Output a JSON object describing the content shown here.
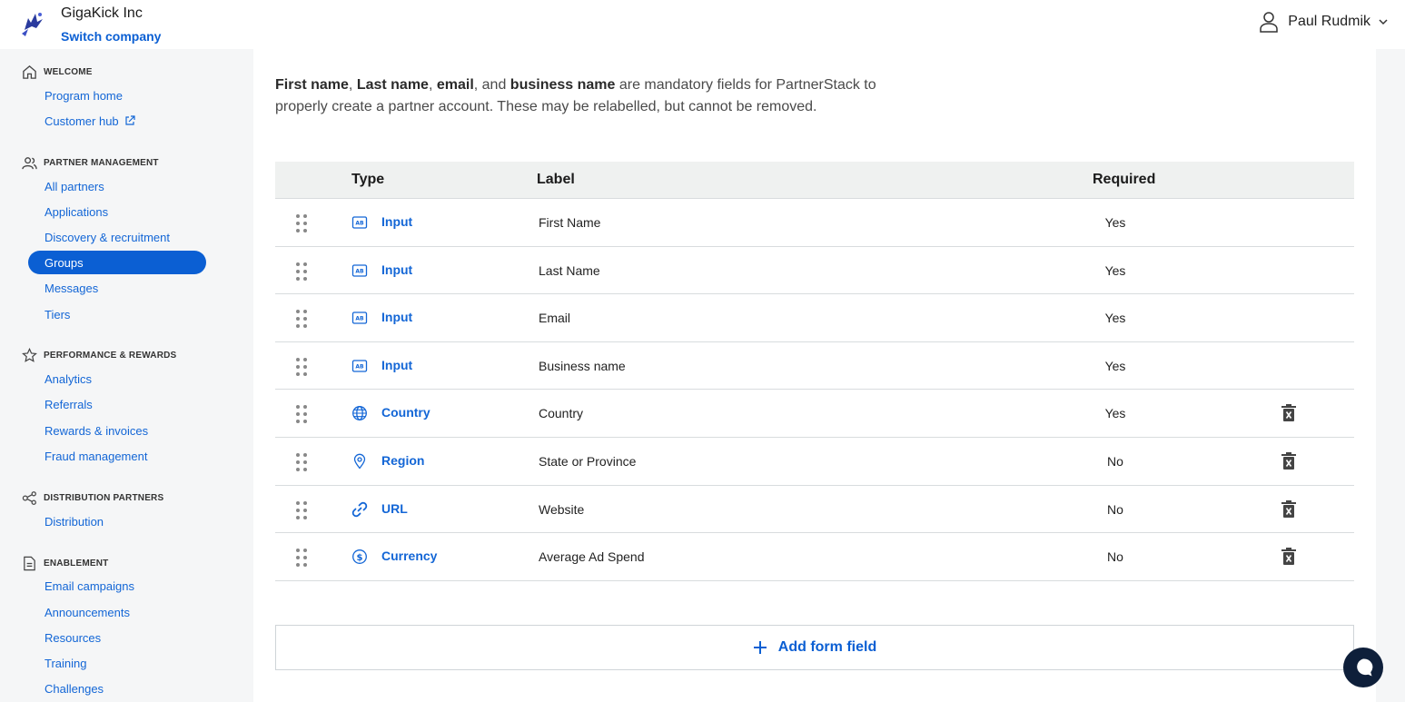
{
  "brand": {
    "company": "GigaKick Inc",
    "switch_label": "Switch company"
  },
  "user": {
    "name": "Paul Rudmik"
  },
  "sidebar": {
    "sections": [
      {
        "label": "WELCOME",
        "icon": "home-icon",
        "items": [
          {
            "label": "Program home"
          },
          {
            "label": "Customer hub",
            "external": true
          }
        ]
      },
      {
        "label": "PARTNER MANAGEMENT",
        "icon": "users-icon",
        "items": [
          {
            "label": "All partners"
          },
          {
            "label": "Applications"
          },
          {
            "label": "Discovery & recruitment"
          },
          {
            "label": "Groups",
            "active": true
          },
          {
            "label": "Messages"
          },
          {
            "label": "Tiers"
          }
        ]
      },
      {
        "label": "PERFORMANCE & REWARDS",
        "icon": "star-icon",
        "items": [
          {
            "label": "Analytics"
          },
          {
            "label": "Referrals"
          },
          {
            "label": "Rewards & invoices"
          },
          {
            "label": "Fraud management"
          }
        ]
      },
      {
        "label": "DISTRIBUTION PARTNERS",
        "icon": "share-icon",
        "items": [
          {
            "label": "Distribution"
          }
        ]
      },
      {
        "label": "ENABLEMENT",
        "icon": "document-icon",
        "items": [
          {
            "label": "Email campaigns"
          },
          {
            "label": "Announcements"
          },
          {
            "label": "Resources"
          },
          {
            "label": "Training"
          },
          {
            "label": "Challenges"
          }
        ]
      }
    ]
  },
  "intro": {
    "f1": "First name",
    "s1": ", ",
    "f2": "Last name",
    "s2": ", ",
    "f3": "email",
    "s3": ", and ",
    "f4": "business name",
    "rest": " are mandatory fields for PartnerStack to properly create a partner account. These may be relabelled, but cannot be removed."
  },
  "table": {
    "headers": {
      "type": "Type",
      "label": "Label",
      "required": "Required"
    },
    "rows": [
      {
        "type": "Input",
        "icon": "text-input-icon",
        "label": "First Name",
        "required": "Yes",
        "deletable": false
      },
      {
        "type": "Input",
        "icon": "text-input-icon",
        "label": "Last Name",
        "required": "Yes",
        "deletable": false
      },
      {
        "type": "Input",
        "icon": "text-input-icon",
        "label": "Email",
        "required": "Yes",
        "deletable": false
      },
      {
        "type": "Input",
        "icon": "text-input-icon",
        "label": "Business name",
        "required": "Yes",
        "deletable": false
      },
      {
        "type": "Country",
        "icon": "globe-icon",
        "label": "Country",
        "required": "Yes",
        "deletable": true
      },
      {
        "type": "Region",
        "icon": "map-pin-icon",
        "label": "State or Province",
        "required": "No",
        "deletable": true
      },
      {
        "type": "URL",
        "icon": "link-icon",
        "label": "Website",
        "required": "No",
        "deletable": true
      },
      {
        "type": "Currency",
        "icon": "dollar-icon",
        "label": "Average Ad Spend",
        "required": "No",
        "deletable": true
      }
    ]
  },
  "add_field": {
    "label": "Add form field"
  },
  "colors": {
    "accent": "#0b5fd3",
    "link": "#1366d6",
    "chat": "#0e1f3a"
  }
}
